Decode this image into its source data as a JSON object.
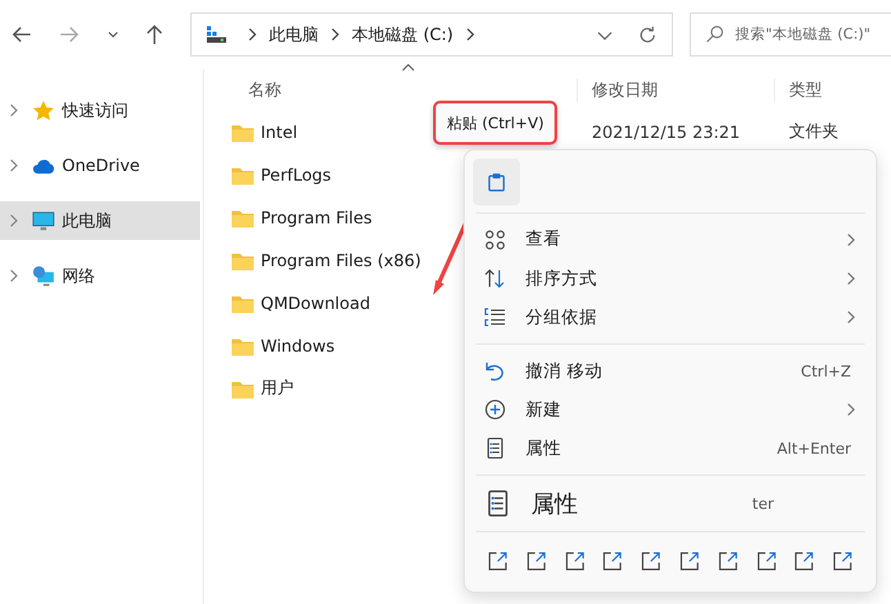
{
  "address": {
    "crumbs": [
      "此电脑",
      "本地磁盘 (C:)"
    ]
  },
  "search": {
    "placeholder": "搜索\"本地磁盘 (C:)\""
  },
  "sidebar": {
    "items": [
      {
        "label": "快速访问",
        "selected": false
      },
      {
        "label": "OneDrive",
        "selected": false
      },
      {
        "label": "此电脑",
        "selected": true
      },
      {
        "label": "网络",
        "selected": false
      }
    ]
  },
  "table": {
    "columns": [
      "名称",
      "修改日期",
      "类型"
    ],
    "rows": [
      {
        "name": "Intel",
        "date": "2021/12/15 23:21",
        "type": "文件夹"
      },
      {
        "name": "PerfLogs"
      },
      {
        "name": "Program Files"
      },
      {
        "name": "Program Files (x86)"
      },
      {
        "name": "QMDownload"
      },
      {
        "name": "Windows"
      },
      {
        "name": "用户"
      }
    ]
  },
  "tooltip": {
    "text": "粘贴 (Ctrl+V)"
  },
  "context_menu": {
    "items": [
      {
        "kind": "item",
        "label": "查看",
        "submenu": true
      },
      {
        "kind": "item",
        "label": "排序方式",
        "submenu": true
      },
      {
        "kind": "item",
        "label": "分组依据",
        "submenu": true
      },
      {
        "kind": "separator"
      },
      {
        "kind": "item",
        "label": "撤消 移动",
        "shortcut": "Ctrl+Z",
        "submenu": false
      },
      {
        "kind": "item",
        "label": "新建",
        "submenu": true
      },
      {
        "kind": "item",
        "label": "属性",
        "shortcut": "Alt+Enter",
        "submenu": false
      },
      {
        "kind": "separator"
      },
      {
        "kind": "ghost",
        "label": "属性",
        "shortcut": "ter",
        "submenu": false
      }
    ]
  }
}
